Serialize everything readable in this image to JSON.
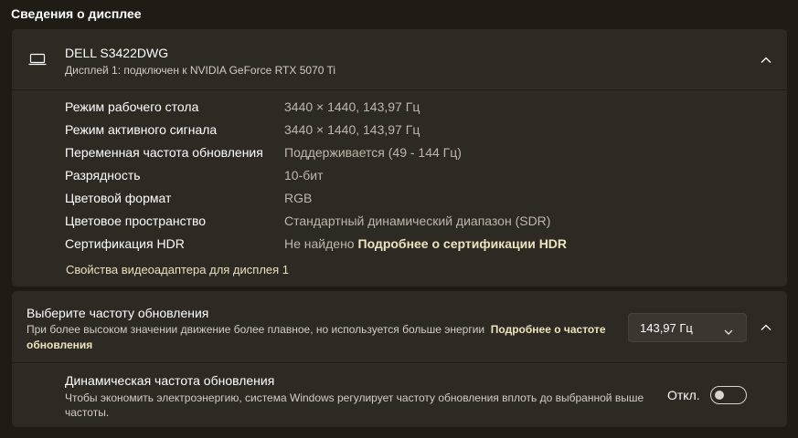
{
  "section_title": "Сведения о дисплее",
  "display": {
    "name": "DELL S3422DWG",
    "subtitle": "Дисплей 1: подключен к NVIDIA GeForce RTX 5070 Ti",
    "icon": "monitor-icon",
    "rows": [
      {
        "label": "Режим рабочего стола",
        "value": "3440 × 1440, 143,97 Гц"
      },
      {
        "label": "Режим активного сигнала",
        "value": "3440 × 1440, 143,97 Гц"
      },
      {
        "label": "Переменная частота обновления",
        "value": "Поддерживается (49 - 144 Гц)"
      },
      {
        "label": "Разрядность",
        "value": "10-бит"
      },
      {
        "label": "Цветовой формат",
        "value": "RGB"
      },
      {
        "label": "Цветовое пространство",
        "value": "Стандартный динамический диапазон (SDR)"
      },
      {
        "label": "Сертификация HDR",
        "value": "Не найдено",
        "link": "Подробнее о сертификации HDR"
      }
    ],
    "adapter_link": "Свойства видеоадаптера для дисплея 1"
  },
  "refresh": {
    "title": "Выберите частоту обновления",
    "description": "При более высоком значении движение более плавное, но используется больше энергии",
    "link": "Подробнее о частоте обновления",
    "selected": "143,97 Гц"
  },
  "dynamic": {
    "title": "Динамическая частота обновления",
    "description": "Чтобы экономить электроэнергию, система Windows регулирует частоту обновления вплоть до выбранной выше частоты.",
    "toggle_label": "Откл.",
    "toggle_on": false
  },
  "colors": {
    "background": "#1f1c16",
    "card": "#2d2a23",
    "accent_link": "#ede3c0"
  }
}
